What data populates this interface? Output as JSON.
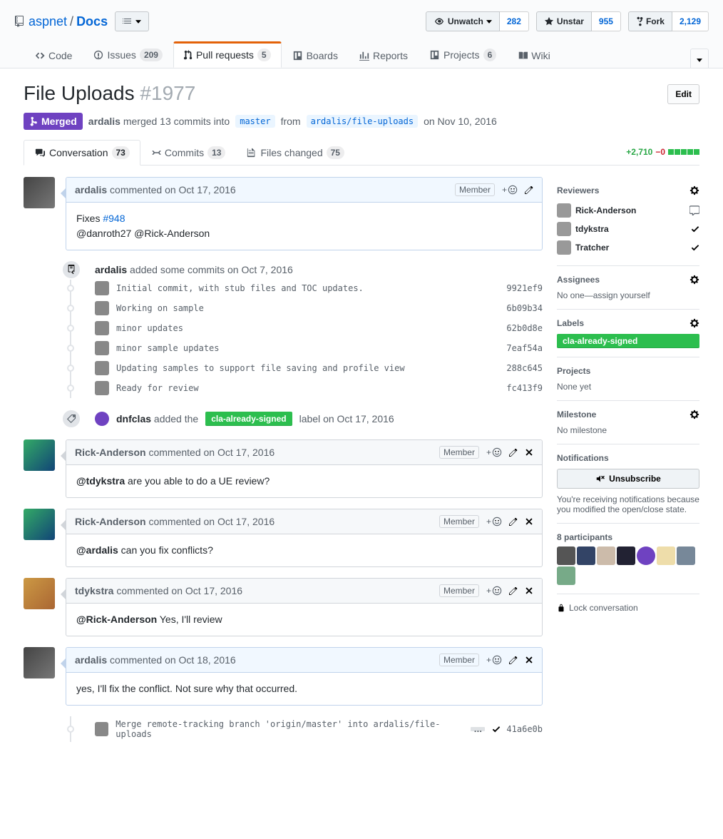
{
  "repo": {
    "owner": "aspnet",
    "name": "Docs"
  },
  "watch": {
    "label": "Unwatch",
    "count": "282"
  },
  "star": {
    "label": "Unstar",
    "count": "955"
  },
  "fork": {
    "label": "Fork",
    "count": "2,129"
  },
  "nav": {
    "code": "Code",
    "issues": {
      "label": "Issues",
      "count": "209"
    },
    "pulls": {
      "label": "Pull requests",
      "count": "5"
    },
    "boards": "Boards",
    "reports": "Reports",
    "projects": {
      "label": "Projects",
      "count": "6"
    },
    "wiki": "Wiki"
  },
  "pr": {
    "title": "File Uploads",
    "number": "#1977",
    "edit": "Edit",
    "state": "Merged",
    "merge_text_prefix1": "merged 13 commits into",
    "merge_actor": "ardalis",
    "base_branch": "master",
    "from_label": "from",
    "head_branch": "ardalis/file-uploads",
    "merge_date": "on Nov 10, 2016"
  },
  "tabs": {
    "conv": {
      "label": "Conversation",
      "count": "73"
    },
    "commits": {
      "label": "Commits",
      "count": "13"
    },
    "files": {
      "label": "Files changed",
      "count": "75"
    },
    "diff_add": "+2,710",
    "diff_del": "−0"
  },
  "sidebar": {
    "reviewers_label": "Reviewers",
    "reviewers": [
      {
        "name": "Rick-Anderson",
        "status": "comment"
      },
      {
        "name": "tdykstra",
        "status": "check"
      },
      {
        "name": "Tratcher",
        "status": "check"
      }
    ],
    "assignees_label": "Assignees",
    "assignees_text": "No one—assign yourself",
    "labels_label": "Labels",
    "label_value": "cla-already-signed",
    "projects_label": "Projects",
    "projects_text": "None yet",
    "milestone_label": "Milestone",
    "milestone_text": "No milestone",
    "notifications_label": "Notifications",
    "unsubscribe": "Unsubscribe",
    "notif_text": "You're receiving notifications because you modified the open/close state.",
    "participants_label": "8 participants",
    "lock": "Lock conversation"
  },
  "comment1": {
    "author": "ardalis",
    "verb": "commented",
    "date": "on Oct 17, 2016",
    "badge": "Member",
    "body_pre": "Fixes ",
    "body_link": "#948",
    "body_mentions": "@danroth27 @Rick-Anderson"
  },
  "commits_event": {
    "actor": "ardalis",
    "text": "added some commits",
    "date": "on Oct 7, 2016"
  },
  "commits": [
    {
      "msg": "Initial commit, with stub files and TOC updates.",
      "sha": "9921ef9"
    },
    {
      "msg": "Working on sample",
      "sha": "6b09b34"
    },
    {
      "msg": "minor updates",
      "sha": "62b0d8e"
    },
    {
      "msg": "minor sample updates",
      "sha": "7eaf54a"
    },
    {
      "msg": "Updating samples to support file saving and profile view",
      "sha": "288c645"
    },
    {
      "msg": "Ready for review",
      "sha": "fc413f9"
    }
  ],
  "label_event": {
    "actor": "dnfclas",
    "verb": "added the",
    "label": "cla-already-signed",
    "suffix": "label",
    "date": "on Oct 17, 2016"
  },
  "comment2": {
    "author": "Rick-Anderson",
    "verb": "commented",
    "date": "on Oct 17, 2016",
    "badge": "Member",
    "body_mention": "@tdykstra",
    "body_rest": " are you able to do a UE review?"
  },
  "comment3": {
    "author": "Rick-Anderson",
    "verb": "commented",
    "date": "on Oct 17, 2016",
    "badge": "Member",
    "body_mention": "@ardalis",
    "body_rest": " can you fix conflicts?"
  },
  "comment4": {
    "author": "tdykstra",
    "verb": "commented",
    "date": "on Oct 17, 2016",
    "badge": "Member",
    "body_mention": "@Rick-Anderson",
    "body_rest": " Yes, I'll review"
  },
  "comment5": {
    "author": "ardalis",
    "verb": "commented",
    "date": "on Oct 18, 2016",
    "badge": "Member",
    "body": "yes, I'll fix the conflict. Not sure why that occurred."
  },
  "merge_commit": {
    "msg": "Merge remote-tracking branch 'origin/master' into ardalis/file-uploads",
    "sha": "41a6e0b"
  }
}
